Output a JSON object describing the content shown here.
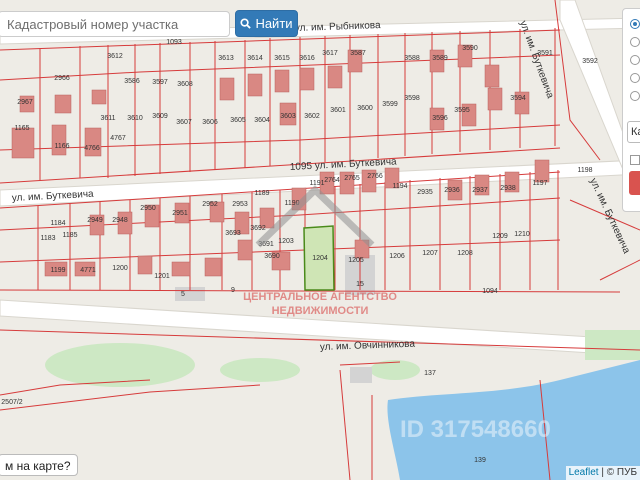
{
  "search": {
    "placeholder": "Кадастровый номер участка",
    "button_label": "Найти",
    "button_icon": "search-icon"
  },
  "map": {
    "streets": [
      "ул. им. Рыбникова",
      "1095 ул. им. Буткевича",
      "ул. им. Буткевича",
      "ул. им. Буткевича",
      "ул. им. Буткевича",
      "ул. им. Овчинникова"
    ],
    "selected_parcel": "1204",
    "parcel_labels": [
      "1093",
      "3592",
      "3591",
      "3590",
      "3589",
      "3588",
      "3587",
      "3617",
      "3616",
      "3615",
      "3614",
      "3613",
      "3612",
      "2966",
      "2967",
      "3586",
      "3597",
      "3608",
      "3609",
      "3610",
      "3611",
      "3598",
      "3599",
      "3600",
      "3601",
      "3602",
      "3603",
      "3604",
      "3605",
      "3606",
      "3607",
      "3594",
      "3595",
      "3596",
      "4767",
      "4766",
      "1165",
      "1166",
      "1198",
      "1197",
      "2938",
      "2937",
      "2936",
      "2935",
      "2766",
      "2765",
      "2764",
      "1191",
      "1194",
      "2950",
      "2951",
      "2952",
      "2953",
      "1189",
      "1190",
      "1184",
      "1185",
      "1183",
      "2949",
      "2948",
      "3693",
      "3692",
      "3691",
      "3690",
      "1203",
      "1204",
      "1205",
      "1206",
      "1207",
      "1208",
      "1209",
      "1210",
      "1199",
      "1200",
      "1201",
      "4771",
      "5",
      "9",
      "15",
      "1094",
      "137",
      "139",
      "2507/2"
    ],
    "watermark_line1": "ЦЕНТРАЛЬНОЕ АГЕНТСТВО",
    "watermark_line2": "НЕДВИЖИМОСТИ",
    "listing_id": "ID 317548660",
    "colors": {
      "parcel_line": "#d63b3b",
      "building": "#d98883",
      "selected_fill": "#cfe5b5",
      "selected_stroke": "#4a8a1a",
      "water": "#8cc4ea",
      "grass": "#cde8c4",
      "accent": "#337ab7"
    }
  },
  "panel": {
    "select_text": "Ка"
  },
  "question_text": "м на карте?",
  "attribution": {
    "leaflet": "Leaflet",
    "rest": "| © ПУБ"
  }
}
